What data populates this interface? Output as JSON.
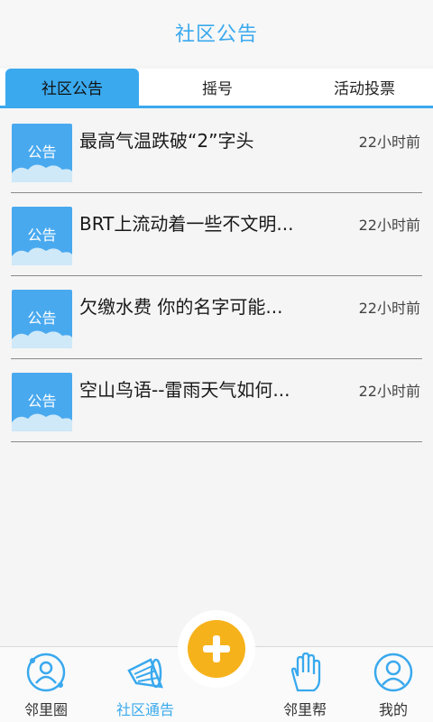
{
  "header": {
    "title": "社区公告"
  },
  "tabs": [
    {
      "label": "社区公告",
      "active": true
    },
    {
      "label": "摇号",
      "active": false
    },
    {
      "label": "活动投票",
      "active": false
    }
  ],
  "announcements": [
    {
      "thumb_label": "公告",
      "title": "最高气温跌破“2”字头",
      "time": "22小时前"
    },
    {
      "thumb_label": "公告",
      "title": "BRT上流动着一些不文明...",
      "time": "22小时前"
    },
    {
      "thumb_label": "公告",
      "title": "欠缴水费 你的名字可能...",
      "time": "22小时前"
    },
    {
      "thumb_label": "公告",
      "title": "空山鸟语--雷雨天气如何...",
      "time": "22小时前"
    }
  ],
  "fab": {
    "icon": "plus-icon"
  },
  "bottom_nav": [
    {
      "label": "邻里圈",
      "icon": "people-circle-icon",
      "active": false
    },
    {
      "label": "社区通告",
      "icon": "megaphone-icon",
      "active": true
    },
    {
      "label": "邻里帮",
      "icon": "hand-icon",
      "active": false
    },
    {
      "label": "我的",
      "icon": "profile-icon",
      "active": false
    }
  ],
  "colors": {
    "accent": "#3aa9ee",
    "fab": "#f6b21b",
    "thumb": "#49a9ef"
  }
}
